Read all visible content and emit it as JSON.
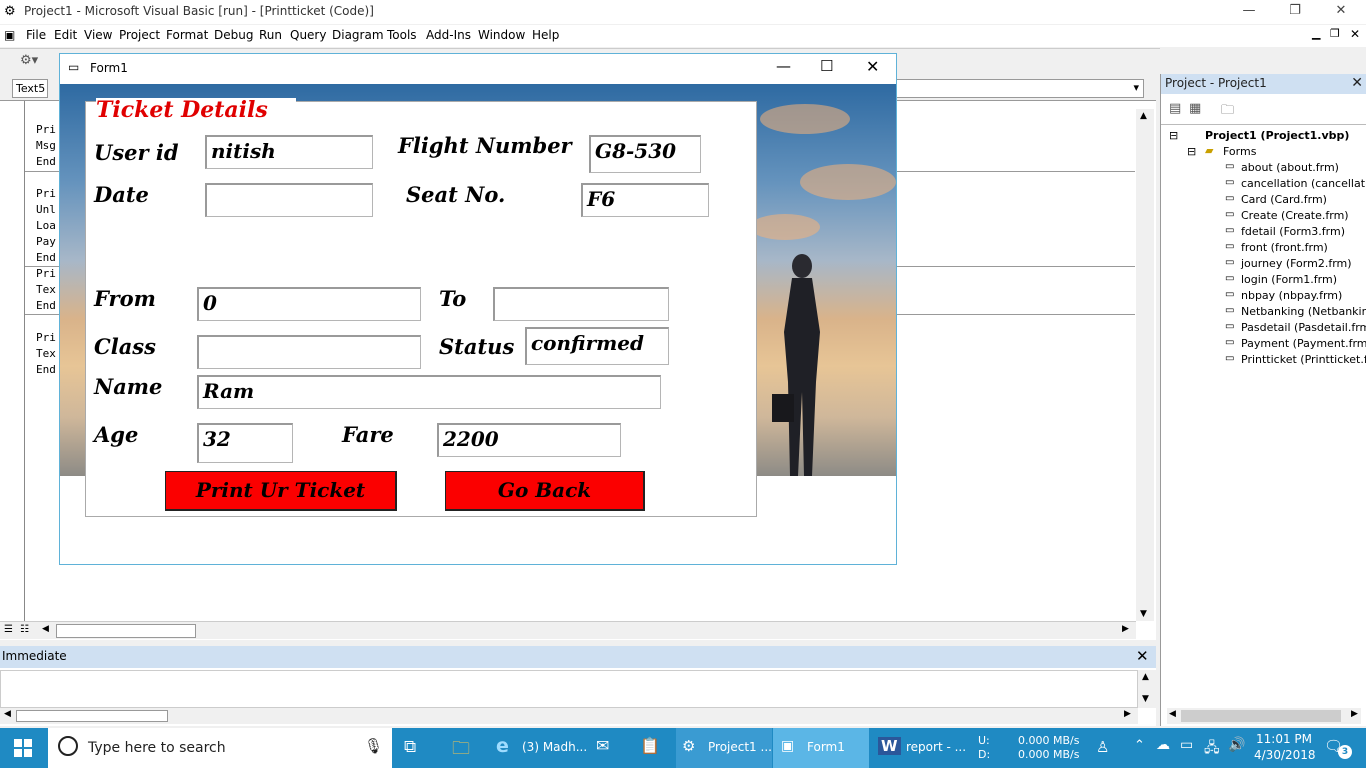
{
  "app": {
    "title": "Project1 - Microsoft Visual Basic [run] - [Printticket (Code)]"
  },
  "menu": [
    "File",
    "Edit",
    "View",
    "Project",
    "Format",
    "Debug",
    "Run",
    "Query",
    "Diagram",
    "Tools",
    "Add-Ins",
    "Window",
    "Help"
  ],
  "toolbar": {
    "object_combo": "Text5"
  },
  "code_lines": [
    "Pri",
    "Msg",
    "End",
    "Pri",
    "Unl",
    "Loa",
    "Pay",
    "End",
    "Pri",
    "Tex",
    "End",
    "Pri",
    "Tex",
    "End"
  ],
  "project_panel": {
    "title": "Project - Project1",
    "root": "Project1 (Project1.vbp)",
    "folder": "Forms",
    "items": [
      "about (about.frm)",
      "cancellation (cancellation.",
      "Card (Card.frm)",
      "Create (Create.frm)",
      "fdetail (Form3.frm)",
      "front (front.frm)",
      "journey (Form2.frm)",
      "login (Form1.frm)",
      "nbpay (nbpay.frm)",
      "Netbanking (Netbanking.f",
      "Pasdetail (Pasdetail.frm)",
      "Payment (Payment.frm)",
      "Printticket (Printticket.frm"
    ]
  },
  "immediate": {
    "title": "Immediate"
  },
  "form": {
    "title": "Form1",
    "heading": "Ticket  Details",
    "labels": {
      "user_id": "User id",
      "flight_number": "Flight Number",
      "date": "Date",
      "seat_no": "Seat No.",
      "from": "From",
      "to": "To",
      "class": "Class",
      "status": "Status",
      "name": "Name",
      "age": "Age",
      "fare": "Fare"
    },
    "values": {
      "user_id": "nitish",
      "flight_number": "G8-530",
      "date": "",
      "seat_no": "F6",
      "from": "0",
      "to": "",
      "class": "",
      "status": "confirmed",
      "name": "Ram",
      "age": "32",
      "fare": "2200"
    },
    "buttons": {
      "print": "Print Ur Ticket",
      "back": "Go Back"
    }
  },
  "taskbar": {
    "search_placeholder": "Type here to search",
    "apps": [
      "(3) Madh...",
      "Project1 ...",
      "Form1",
      "report - ..."
    ],
    "drive_u": "U:",
    "drive_d": "D:",
    "net_up": "0.000 MB/s",
    "net_down": "0.000 MB/s",
    "time": "11:01 PM",
    "date": "4/30/2018",
    "notifications": "3"
  },
  "colors": {
    "button_red": "#fb0000",
    "heading_red": "#e00000",
    "taskbar": "#1f8ac3"
  }
}
